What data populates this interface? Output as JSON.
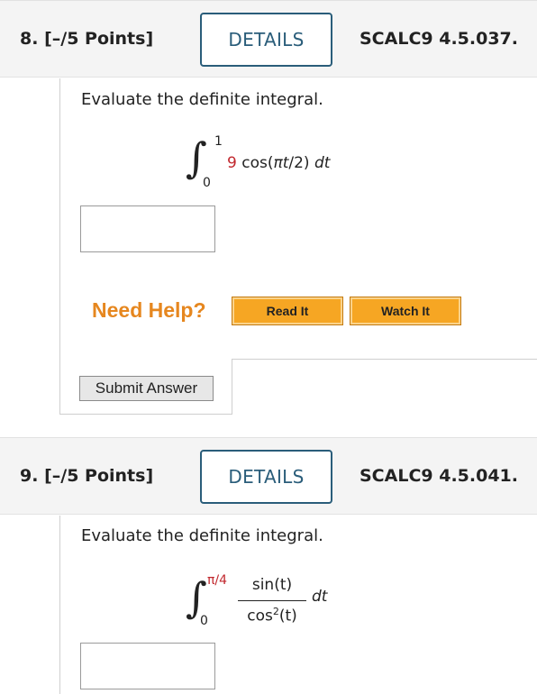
{
  "q8": {
    "number": "8.",
    "points": "[–/5 Points]",
    "details_label": "DETAILS",
    "code": "SCALC9 4.5.037.",
    "prompt": "Evaluate the definite integral.",
    "integral": {
      "upper": "1",
      "lower": "0",
      "coefficient": "9",
      "expr_pre": "cos(",
      "expr_var": "πt",
      "expr_post": "/2)",
      "differential": "dt"
    },
    "answer_value": "",
    "need_help": "Need Help?",
    "read_it": "Read It",
    "watch_it": "Watch It",
    "submit_label": "Submit Answer"
  },
  "q9": {
    "number": "9.",
    "points": "[–/5 Points]",
    "details_label": "DETAILS",
    "code": "SCALC9 4.5.041.",
    "prompt": "Evaluate the definite integral.",
    "integral": {
      "upper": "π/4",
      "lower": "0",
      "numerator": "sin(t)",
      "denominator_pre": "cos",
      "denominator_sup": "2",
      "denominator_post": "(t)",
      "differential": "dt"
    },
    "answer_value": ""
  },
  "colors": {
    "details_border": "#2a5d7a",
    "need_help": "#e6871f",
    "help_button": "#f6a623",
    "coefficient_red": "#c1272d"
  }
}
